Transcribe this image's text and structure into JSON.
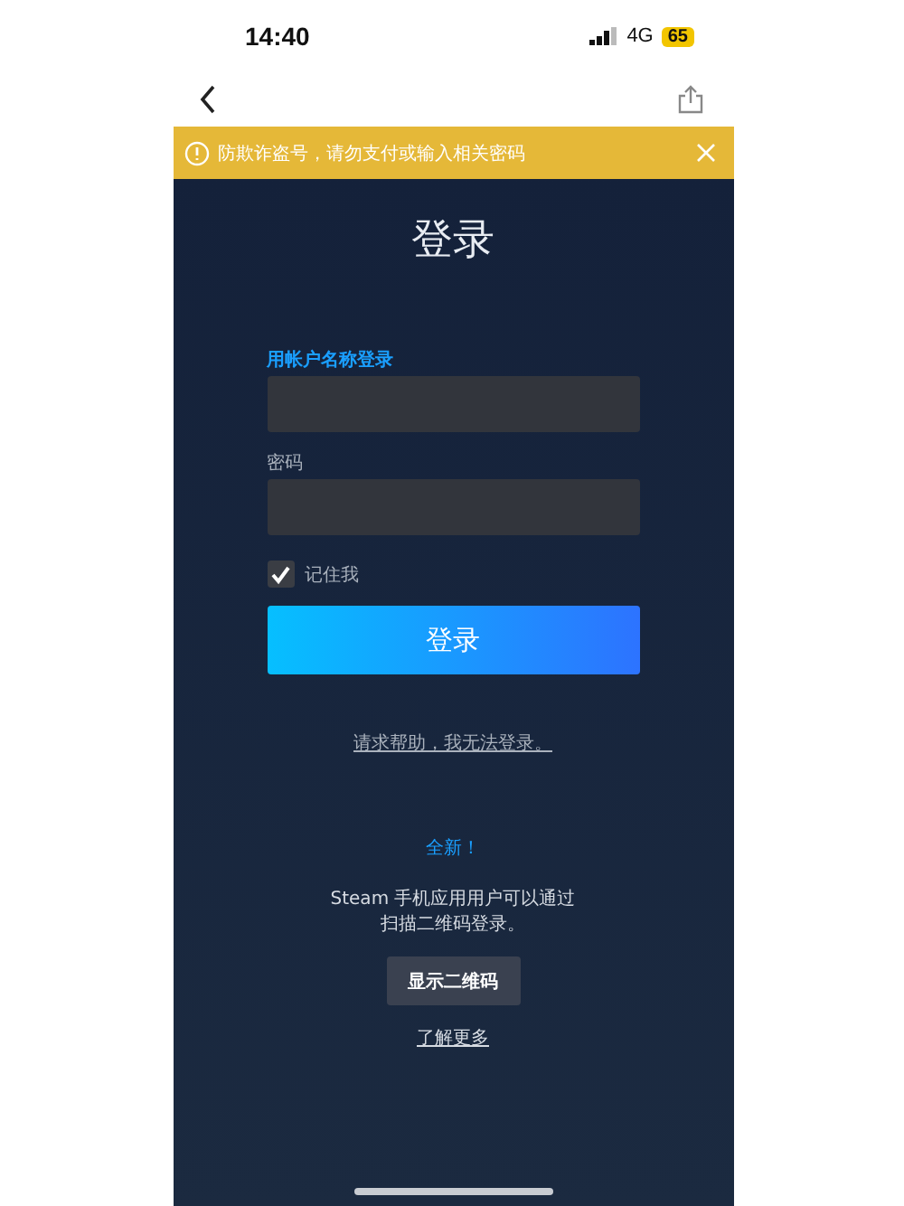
{
  "status_bar": {
    "time": "14:40",
    "network": "4G",
    "battery": "65"
  },
  "warning_banner": {
    "text": "防欺诈盗号，请勿支付或输入相关密码"
  },
  "title": "登录",
  "fields": [
    {
      "label": "用帐户名称登录",
      "highlighted": true
    },
    {
      "label": "密码",
      "highlighted": false
    }
  ],
  "remember_me": {
    "label": "记住我",
    "checked": true
  },
  "login_button": "登录",
  "help_link": "请求帮助，我无法登录。",
  "qr_section": {
    "badge": "全新！",
    "text_lines": [
      "Steam 手机应用用户可以通过",
      "扫描二维码登录。"
    ],
    "button": "显示二维码",
    "link": "了解更多"
  }
}
